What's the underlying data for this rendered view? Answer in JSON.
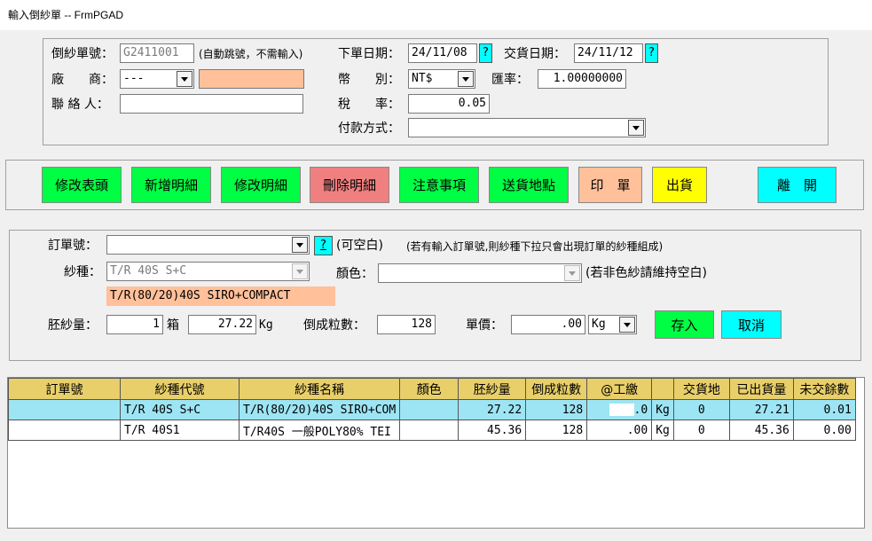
{
  "window": {
    "title": "輸入倒紗單 -- FrmPGAD"
  },
  "header": {
    "order_no_label": "倒紗單號：",
    "order_no_value": "G2411001",
    "order_no_hint": "(自動跳號，不需輸入)",
    "vendor_label": "廠　　商：",
    "vendor_code": "---",
    "vendor_name": "",
    "contact_label": "聯 絡 人：",
    "contact_value": "",
    "order_date_label": "下單日期：",
    "order_date_value": "24/11/08",
    "delivery_date_label": "交貨日期：",
    "delivery_date_value": "24/11/12",
    "help_icon_text": "?",
    "currency_label": "幣　　別：",
    "currency_value": "NT$",
    "rate_label": "匯率：",
    "rate_value": "1.00000000",
    "tax_label": "稅　　率：",
    "tax_value": "0.05",
    "payment_label": "付款方式：",
    "payment_value": ""
  },
  "toolbar": {
    "edit_header": "修改表頭",
    "add_detail": "新增明細",
    "edit_detail": "修改明細",
    "delete_detail": "刪除明細",
    "notes": "注意事項",
    "delivery_place": "送貨地點",
    "print": "印　單",
    "ship": "出貨",
    "exit": "離　開"
  },
  "detail": {
    "order_label": "訂單號：",
    "order_value": "",
    "order_help": "?",
    "order_optional": "(可空白)",
    "order_hint": "(若有輸入訂單號,則紗種下拉只會出現訂單的紗種組成)",
    "yarn_label": "紗種：",
    "yarn_value": "T/R 40S S+C",
    "yarn_desc": "T/R(80/20)40S SIRO+COMPACT",
    "color_label": "顏色：",
    "color_value": "",
    "color_hint": "(若非色紗請維持空白)",
    "raw_label": "胚紗量：",
    "raw_boxes": "1",
    "box_unit": "箱",
    "raw_weight": "27.22",
    "kg_unit": "Kg",
    "cones_label": "倒成粒數：",
    "cones_value": "128",
    "price_label": "單價：",
    "price_value": ".00",
    "price_unit": "Kg",
    "save": "存入",
    "cancel": "取消"
  },
  "table": {
    "columns": [
      "訂單號",
      "紗種代號",
      "紗種名稱",
      "顏色",
      "胚紗量",
      "倒成粒數",
      "@工繳",
      "",
      "交貨地",
      "已出貨量",
      "未交餘數"
    ],
    "rows": [
      {
        "order": "",
        "code": "T/R 40S S+C",
        "name": "T/R(80/20)40S SIRO+COM",
        "color": "",
        "raw": "27.22",
        "cones": "128",
        "fee": ".0",
        "unit": "Kg",
        "place": "0",
        "shipped": "27.21",
        "remain": "0.01"
      },
      {
        "order": "",
        "code": "T/R 40S1",
        "name": "T/R40S 一般POLY80% TEI",
        "color": "",
        "raw": "45.36",
        "cones": "128",
        "fee": ".00",
        "unit": "Kg",
        "place": "0",
        "shipped": "45.36",
        "remain": "0.00"
      }
    ]
  },
  "colors": {
    "accent_green": "#00ff44",
    "delete_red": "#f08080",
    "print_orange": "#ffc09a",
    "ship_yellow": "#ffff00",
    "cyan": "#00ffff",
    "header_gold": "#e8cf6a",
    "selected_row": "#9de5f4",
    "vendor_field": "#ffc09a"
  }
}
